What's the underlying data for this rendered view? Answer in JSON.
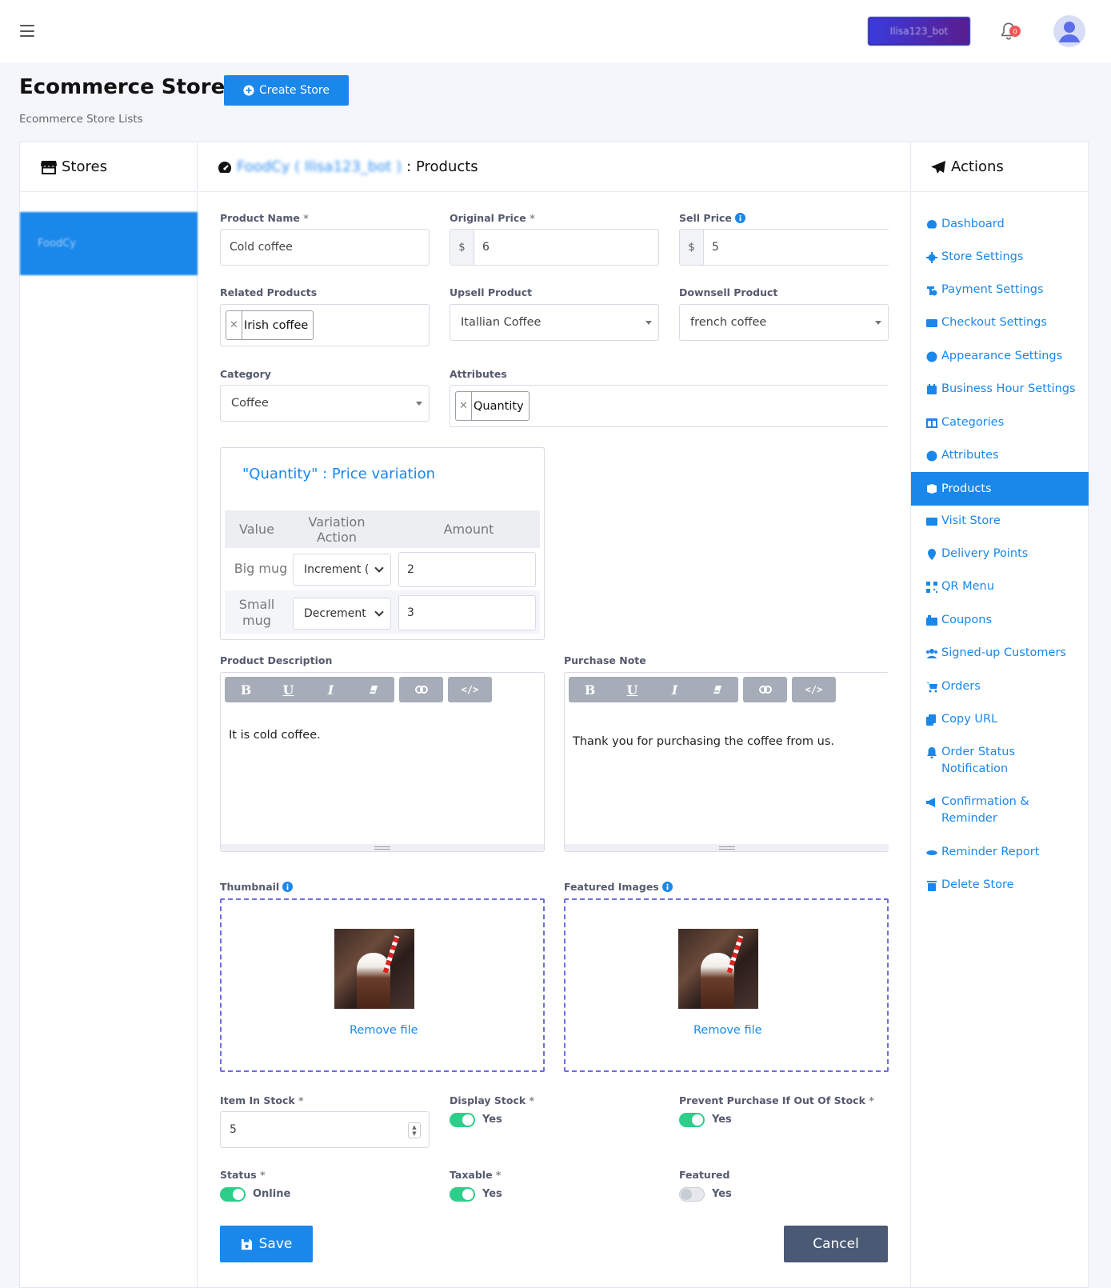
{
  "header": {
    "account_label": "Ilisa123_bot",
    "notification_count": "0"
  },
  "page": {
    "title": "Ecommerce Store",
    "create_label": "Create Store",
    "subtitle": "Ecommerce Store Lists"
  },
  "stores": {
    "title": "Stores",
    "items": [
      "FoodCy"
    ]
  },
  "main": {
    "store_name": "FoodCy ( Ilisa123_bot )",
    "section": ": Products"
  },
  "actions": {
    "title": "Actions",
    "items": [
      {
        "label": "Dashboard",
        "icon": "dashboard-icon"
      },
      {
        "label": "Store Settings",
        "icon": "gear-icon"
      },
      {
        "label": "Payment Settings",
        "icon": "payment-icon"
      },
      {
        "label": "Checkout Settings",
        "icon": "credit-card-icon"
      },
      {
        "label": "Appearance Settings",
        "icon": "palette-icon"
      },
      {
        "label": "Business Hour Settings",
        "icon": "calendar-icon"
      },
      {
        "label": "Categories",
        "icon": "columns-icon"
      },
      {
        "label": "Attributes",
        "icon": "palette-icon"
      },
      {
        "label": "Products",
        "icon": "box-icon"
      },
      {
        "label": "Visit Store",
        "icon": "list-icon"
      },
      {
        "label": "Delivery Points",
        "icon": "map-pin-icon"
      },
      {
        "label": "QR Menu",
        "icon": "qr-icon"
      },
      {
        "label": "Coupons",
        "icon": "coupon-icon"
      },
      {
        "label": "Signed-up Customers",
        "icon": "users-icon"
      },
      {
        "label": "Orders",
        "icon": "cart-icon"
      },
      {
        "label": "Copy URL",
        "icon": "copy-icon"
      },
      {
        "label": "Order Status Notification",
        "icon": "bell-icon"
      },
      {
        "label": "Confirmation & Reminder",
        "icon": "megaphone-icon"
      },
      {
        "label": "Reminder Report",
        "icon": "eye-icon"
      },
      {
        "label": "Delete Store",
        "icon": "trash-icon"
      }
    ]
  },
  "form": {
    "product_name": {
      "label": "Product Name",
      "value": "Cold coffee"
    },
    "original_price": {
      "label": "Original Price",
      "currency": "$",
      "value": "6"
    },
    "sell_price": {
      "label": "Sell Price",
      "currency": "$",
      "value": "5"
    },
    "related_products": {
      "label": "Related Products",
      "tags": [
        "Irish coffee"
      ]
    },
    "upsell_product": {
      "label": "Upsell Product",
      "value": "Itallian Coffee"
    },
    "downsell_product": {
      "label": "Downsell Product",
      "value": "french coffee"
    },
    "category": {
      "label": "Category",
      "value": "Coffee"
    },
    "attributes": {
      "label": "Attributes",
      "tags": [
        "Quantity"
      ]
    },
    "variation": {
      "title": "\"Quantity\" : Price variation",
      "headers": [
        "Value",
        "Variation Action",
        "Amount"
      ],
      "rows": [
        {
          "value": "Big mug",
          "action": "Increment (",
          "amount": "2"
        },
        {
          "value": "Small mug",
          "action": "Decrement",
          "amount": "3"
        }
      ]
    },
    "product_description": {
      "label": "Product Description",
      "text": "It is cold coffee."
    },
    "purchase_note": {
      "label": "Purchase Note",
      "text": "Thank you for purchasing the coffee from us."
    },
    "editor_buttons": [
      "B",
      "U",
      "I"
    ],
    "thumbnail": {
      "label": "Thumbnail",
      "remove": "Remove file"
    },
    "featured_images": {
      "label": "Featured Images",
      "remove": "Remove file"
    },
    "item_in_stock": {
      "label": "Item In Stock",
      "value": "5"
    },
    "display_stock": {
      "label": "Display Stock",
      "value": "Yes",
      "on": true
    },
    "prevent_purchase": {
      "label": "Prevent Purchase If Out Of Stock",
      "value": "Yes",
      "on": true
    },
    "status": {
      "label": "Status",
      "value": "Online",
      "on": true
    },
    "taxable": {
      "label": "Taxable",
      "value": "Yes",
      "on": true
    },
    "featured": {
      "label": "Featured",
      "value": "Yes",
      "on": false
    },
    "required_mark": "*",
    "save_label": "Save",
    "cancel_label": "Cancel"
  },
  "colors": {
    "primary": "#1a87ea",
    "toggle_on": "#2dce89",
    "cancel": "#4a5a75",
    "dropzone_border": "#6b6fe0"
  }
}
